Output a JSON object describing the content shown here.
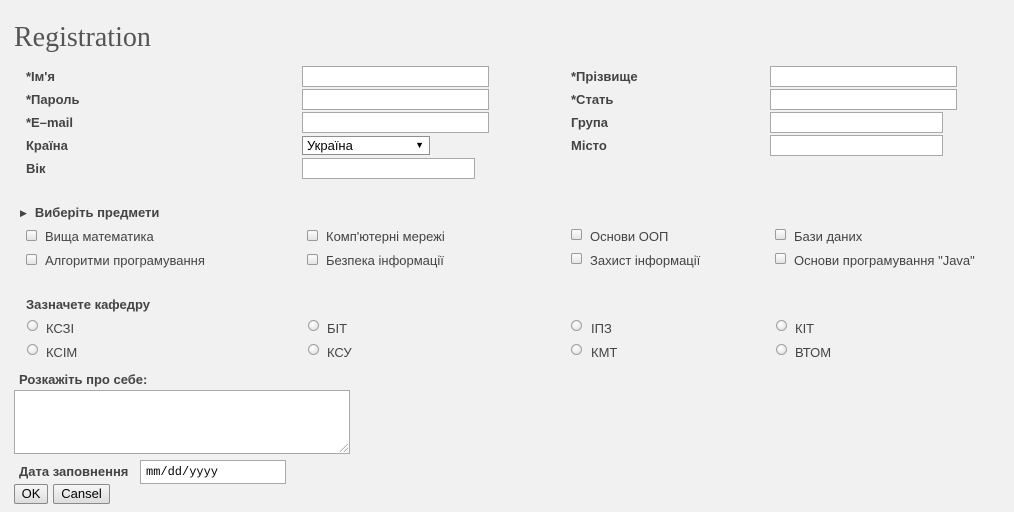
{
  "page": {
    "title": "Registration"
  },
  "fields": {
    "name_label": "*Ім'я",
    "password_label": "*Пароль",
    "email_label": "*E–mail",
    "country_label": "Країна",
    "country_value": "Україна",
    "age_label": "Вік",
    "surname_label": "*Прізвище",
    "gender_label": "*Стать",
    "group_label": "Група",
    "city_label": "Місто"
  },
  "subjects": {
    "heading": "Виберіть предмети",
    "items": [
      "Вища математика",
      "Комп'ютерні мережі",
      "Основи ООП",
      "Бази даних",
      "Алгоритми програмування",
      "Безпека інформації",
      "Захист інформації",
      "Основи програмування \"Java\""
    ]
  },
  "department": {
    "heading": "Зазначете кафедру",
    "items": [
      "КСЗІ",
      "БІТ",
      "ІПЗ",
      "КІТ",
      "КСІМ",
      "КСУ",
      "КМТ",
      "ВТОМ"
    ]
  },
  "about": {
    "label": "Розкажіть про себе:"
  },
  "date": {
    "label": "Дата заповнення",
    "placeholder": "mm/dd/yyyy"
  },
  "buttons": {
    "ok": "OK",
    "cancel": "Cansel"
  },
  "icons": {
    "expand": "triangle-right-icon",
    "select_arrow": "chevron-down-icon",
    "checkbox": "checkbox-icon",
    "radio": "radio-icon"
  }
}
